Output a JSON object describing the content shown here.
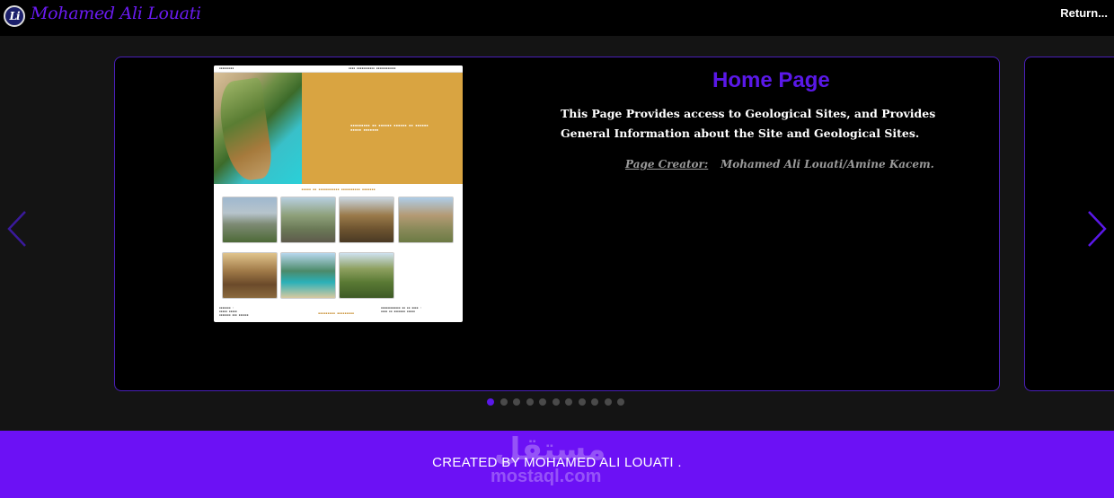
{
  "header": {
    "logo_initials": "Li",
    "brand": "Mohamed Ali Louati",
    "return_label": "Return..."
  },
  "slide": {
    "title": "Home Page",
    "description": "This Page Provides access to Geological Sites, and Provides General Information about the Site and Geological Sites.",
    "creator_label": "Page Creator:",
    "creator_value": "Mohamed Ali Louati/Amine Kacem."
  },
  "carousel": {
    "slide_count": 11,
    "active_index": 0,
    "accent": "#5a18e8"
  },
  "footer": {
    "text": "CREATED BY MOHAMED ALI LOUATI .",
    "background": "#6c11f5",
    "watermark_arabic": "مستقل",
    "watermark_latin": "mostaql.com"
  },
  "icons": {
    "prev": "chevron-left-icon",
    "next": "chevron-right-icon"
  }
}
